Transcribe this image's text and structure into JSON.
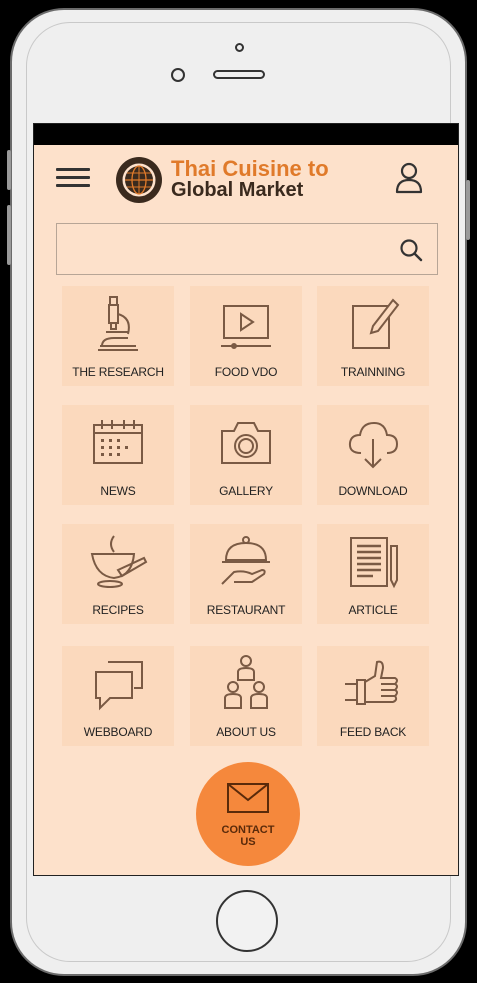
{
  "app": {
    "title_line1": "Thai Cuisine to",
    "title_line2": "Global Market"
  },
  "search": {
    "placeholder": "",
    "value": ""
  },
  "menu": [
    {
      "label": "THE RESEARCH",
      "icon": "microscope-icon"
    },
    {
      "label": "FOOD VDO",
      "icon": "video-play-icon"
    },
    {
      "label": "TRAINNING",
      "icon": "edit-note-icon"
    },
    {
      "label": "NEWS",
      "icon": "calendar-icon"
    },
    {
      "label": "GALLERY",
      "icon": "camera-icon"
    },
    {
      "label": "DOWNLOAD",
      "icon": "cloud-download-icon"
    },
    {
      "label": "RECIPES",
      "icon": "mortar-pestle-icon"
    },
    {
      "label": "RESTAURANT",
      "icon": "serving-cloche-icon"
    },
    {
      "label": "ARTICLE",
      "icon": "document-pen-icon"
    },
    {
      "label": "WEBBOARD",
      "icon": "chat-bubbles-icon"
    },
    {
      "label": "ABOUT US",
      "icon": "team-icon"
    },
    {
      "label": "FEED BACK",
      "icon": "thumbs-up-icon"
    }
  ],
  "contact": {
    "line1": "CONTACT",
    "line2": "US",
    "icon": "envelope-icon"
  },
  "colors": {
    "screen_bg": "#fde1cb",
    "tile_bg": "#fbd9bd",
    "accent": "#f5883c",
    "brand_orange": "#e07a2a",
    "icon_stroke": "#7a5a44"
  }
}
